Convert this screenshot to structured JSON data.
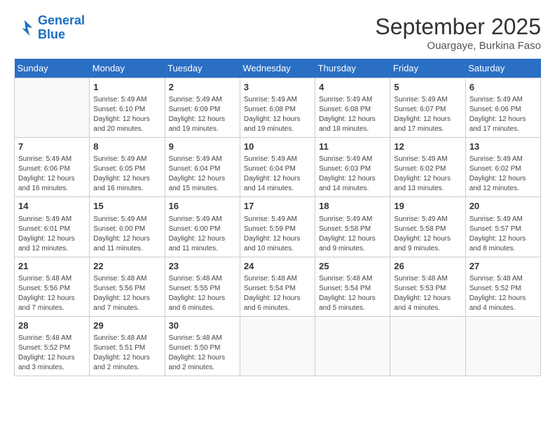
{
  "logo": {
    "line1": "General",
    "line2": "Blue"
  },
  "title": "September 2025",
  "subtitle": "Ouargaye, Burkina Faso",
  "weekdays": [
    "Sunday",
    "Monday",
    "Tuesday",
    "Wednesday",
    "Thursday",
    "Friday",
    "Saturday"
  ],
  "weeks": [
    [
      {
        "day": "",
        "info": ""
      },
      {
        "day": "1",
        "info": "Sunrise: 5:49 AM\nSunset: 6:10 PM\nDaylight: 12 hours\nand 20 minutes."
      },
      {
        "day": "2",
        "info": "Sunrise: 5:49 AM\nSunset: 6:09 PM\nDaylight: 12 hours\nand 19 minutes."
      },
      {
        "day": "3",
        "info": "Sunrise: 5:49 AM\nSunset: 6:08 PM\nDaylight: 12 hours\nand 19 minutes."
      },
      {
        "day": "4",
        "info": "Sunrise: 5:49 AM\nSunset: 6:08 PM\nDaylight: 12 hours\nand 18 minutes."
      },
      {
        "day": "5",
        "info": "Sunrise: 5:49 AM\nSunset: 6:07 PM\nDaylight: 12 hours\nand 17 minutes."
      },
      {
        "day": "6",
        "info": "Sunrise: 5:49 AM\nSunset: 6:06 PM\nDaylight: 12 hours\nand 17 minutes."
      }
    ],
    [
      {
        "day": "7",
        "info": "Sunrise: 5:49 AM\nSunset: 6:06 PM\nDaylight: 12 hours\nand 16 minutes."
      },
      {
        "day": "8",
        "info": "Sunrise: 5:49 AM\nSunset: 6:05 PM\nDaylight: 12 hours\nand 16 minutes."
      },
      {
        "day": "9",
        "info": "Sunrise: 5:49 AM\nSunset: 6:04 PM\nDaylight: 12 hours\nand 15 minutes."
      },
      {
        "day": "10",
        "info": "Sunrise: 5:49 AM\nSunset: 6:04 PM\nDaylight: 12 hours\nand 14 minutes."
      },
      {
        "day": "11",
        "info": "Sunrise: 5:49 AM\nSunset: 6:03 PM\nDaylight: 12 hours\nand 14 minutes."
      },
      {
        "day": "12",
        "info": "Sunrise: 5:49 AM\nSunset: 6:02 PM\nDaylight: 12 hours\nand 13 minutes."
      },
      {
        "day": "13",
        "info": "Sunrise: 5:49 AM\nSunset: 6:02 PM\nDaylight: 12 hours\nand 12 minutes."
      }
    ],
    [
      {
        "day": "14",
        "info": "Sunrise: 5:49 AM\nSunset: 6:01 PM\nDaylight: 12 hours\nand 12 minutes."
      },
      {
        "day": "15",
        "info": "Sunrise: 5:49 AM\nSunset: 6:00 PM\nDaylight: 12 hours\nand 11 minutes."
      },
      {
        "day": "16",
        "info": "Sunrise: 5:49 AM\nSunset: 6:00 PM\nDaylight: 12 hours\nand 11 minutes."
      },
      {
        "day": "17",
        "info": "Sunrise: 5:49 AM\nSunset: 5:59 PM\nDaylight: 12 hours\nand 10 minutes."
      },
      {
        "day": "18",
        "info": "Sunrise: 5:49 AM\nSunset: 5:58 PM\nDaylight: 12 hours\nand 9 minutes."
      },
      {
        "day": "19",
        "info": "Sunrise: 5:49 AM\nSunset: 5:58 PM\nDaylight: 12 hours\nand 9 minutes."
      },
      {
        "day": "20",
        "info": "Sunrise: 5:49 AM\nSunset: 5:57 PM\nDaylight: 12 hours\nand 8 minutes."
      }
    ],
    [
      {
        "day": "21",
        "info": "Sunrise: 5:48 AM\nSunset: 5:56 PM\nDaylight: 12 hours\nand 7 minutes."
      },
      {
        "day": "22",
        "info": "Sunrise: 5:48 AM\nSunset: 5:56 PM\nDaylight: 12 hours\nand 7 minutes."
      },
      {
        "day": "23",
        "info": "Sunrise: 5:48 AM\nSunset: 5:55 PM\nDaylight: 12 hours\nand 6 minutes."
      },
      {
        "day": "24",
        "info": "Sunrise: 5:48 AM\nSunset: 5:54 PM\nDaylight: 12 hours\nand 6 minutes."
      },
      {
        "day": "25",
        "info": "Sunrise: 5:48 AM\nSunset: 5:54 PM\nDaylight: 12 hours\nand 5 minutes."
      },
      {
        "day": "26",
        "info": "Sunrise: 5:48 AM\nSunset: 5:53 PM\nDaylight: 12 hours\nand 4 minutes."
      },
      {
        "day": "27",
        "info": "Sunrise: 5:48 AM\nSunset: 5:52 PM\nDaylight: 12 hours\nand 4 minutes."
      }
    ],
    [
      {
        "day": "28",
        "info": "Sunrise: 5:48 AM\nSunset: 5:52 PM\nDaylight: 12 hours\nand 3 minutes."
      },
      {
        "day": "29",
        "info": "Sunrise: 5:48 AM\nSunset: 5:51 PM\nDaylight: 12 hours\nand 2 minutes."
      },
      {
        "day": "30",
        "info": "Sunrise: 5:48 AM\nSunset: 5:50 PM\nDaylight: 12 hours\nand 2 minutes."
      },
      {
        "day": "",
        "info": ""
      },
      {
        "day": "",
        "info": ""
      },
      {
        "day": "",
        "info": ""
      },
      {
        "day": "",
        "info": ""
      }
    ]
  ]
}
